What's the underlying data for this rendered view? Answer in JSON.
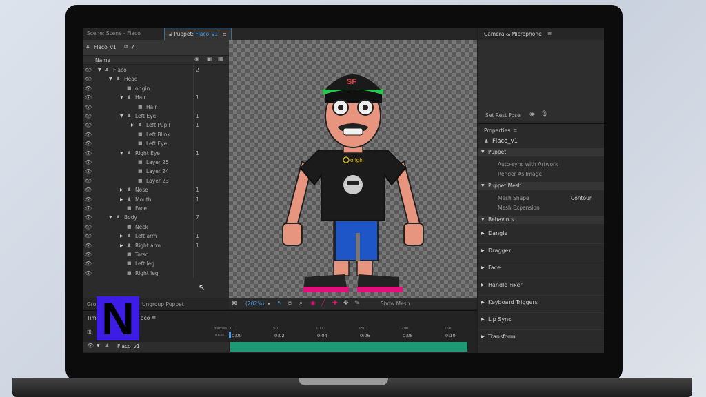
{
  "tabs": [
    {
      "label": "Scene: Scene - Flaco"
    },
    {
      "prefix": "Puppet: ",
      "name": "Flaco_v1"
    }
  ],
  "puppet_header": {
    "name": "Flaco_v1",
    "count": "7"
  },
  "layers_header": {
    "name_col": "Name"
  },
  "layers": [
    {
      "label": "Flaco",
      "count": "2"
    },
    {
      "label": "Head",
      "count": ""
    },
    {
      "label": "origin",
      "count": ""
    },
    {
      "label": "Hair",
      "count": "1"
    },
    {
      "label": "Hair",
      "count": ""
    },
    {
      "label": "Left Eye",
      "count": "1"
    },
    {
      "label": "Left Pupil",
      "count": "1"
    },
    {
      "label": "Left Blink",
      "count": ""
    },
    {
      "label": "Left Eye",
      "count": ""
    },
    {
      "label": "Right Eye",
      "count": "1"
    },
    {
      "label": "Layer 25",
      "count": ""
    },
    {
      "label": "Layer 24",
      "count": ""
    },
    {
      "label": "Layer 23",
      "count": ""
    },
    {
      "label": "Nose",
      "count": "1"
    },
    {
      "label": "Mouth",
      "count": "1"
    },
    {
      "label": "Face",
      "count": ""
    },
    {
      "label": "Body",
      "count": "7"
    },
    {
      "label": "Neck",
      "count": ""
    },
    {
      "label": "Left arm",
      "count": "1"
    },
    {
      "label": "Right arm",
      "count": "1"
    },
    {
      "label": "Torso",
      "count": ""
    },
    {
      "label": "Left leg",
      "count": ""
    },
    {
      "label": "Right leg",
      "count": ""
    }
  ],
  "left_footer": {
    "group": "Gro",
    "ungroup": "Ungroup Puppet"
  },
  "canvas": {
    "origin_label": "origin",
    "hat_text": "SF",
    "zoom": "(202%)",
    "show_mesh": "Show Mesh"
  },
  "camera": {
    "title": "Camera & Microphone",
    "set_rest_pose": "Set Rest Pose"
  },
  "properties": {
    "title": "Properties",
    "puppet_name": "Flaco_v1",
    "sections": {
      "puppet": "Puppet",
      "auto_sync": "Auto-sync with Artwork",
      "render_as_image": "Render As Image",
      "puppet_mesh": "Puppet Mesh",
      "mesh_shape": "Mesh Shape",
      "mesh_shape_value": "Contour",
      "mesh_expansion": "Mesh Expansion",
      "behaviors": "Behaviors"
    },
    "behaviors": [
      "Dangle",
      "Dragger",
      "Face",
      "Handle Fixer",
      "Keyboard Triggers",
      "Lip Sync",
      "Transform"
    ]
  },
  "timeline": {
    "title_left": "Tim",
    "title_right": "aco",
    "frames_label": "frames",
    "time_label": "m:ss",
    "frame_ticks": [
      "0",
      "50",
      "100",
      "150",
      "200",
      "250"
    ],
    "time_ticks": [
      "0:00",
      "0:02",
      "0:04",
      "0:06",
      "0:08",
      "0:10"
    ],
    "track": "Flaco_v1"
  },
  "overlay_logo": "N"
}
